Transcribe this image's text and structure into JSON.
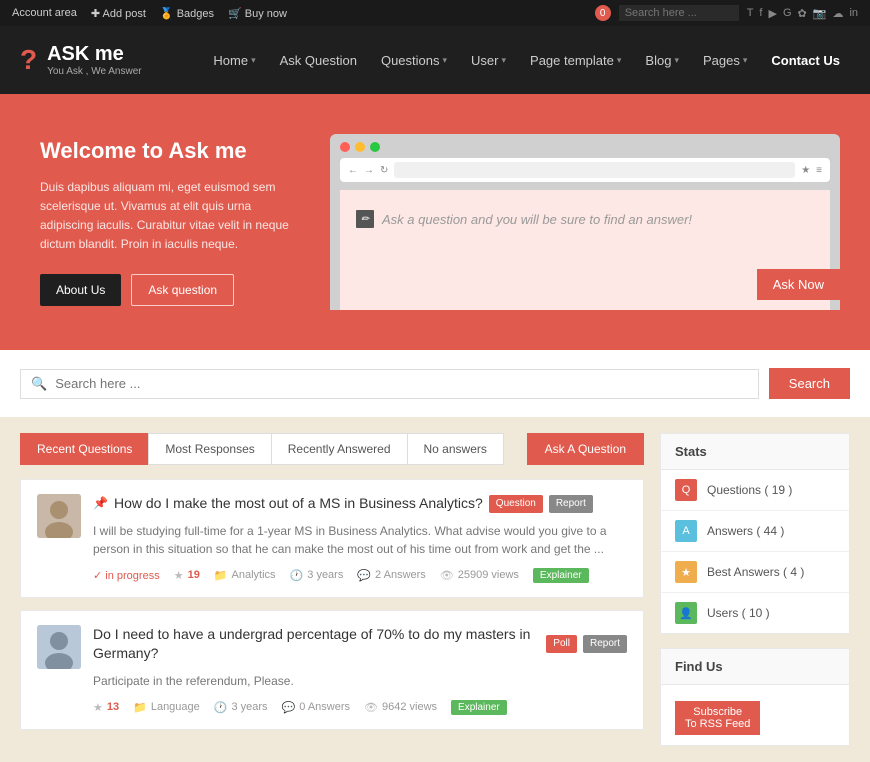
{
  "topbar": {
    "account_area": "Account area",
    "add_post": "Add post",
    "badges": "Badges",
    "buy_now": "Buy now",
    "notification_count": "0",
    "search_placeholder": "Search here ...",
    "social": [
      "T",
      "f",
      "in",
      "Y",
      "G+",
      "📷",
      "📌",
      "in"
    ]
  },
  "header": {
    "logo_icon": "?",
    "logo_title": "ASK me",
    "logo_subtitle": "You Ask , We Answer",
    "nav": [
      {
        "label": "Home",
        "has_arrow": true
      },
      {
        "label": "Ask Question",
        "has_arrow": false
      },
      {
        "label": "Questions",
        "has_arrow": true
      },
      {
        "label": "User",
        "has_arrow": true
      },
      {
        "label": "Page template",
        "has_arrow": true
      },
      {
        "label": "Blog",
        "has_arrow": true
      },
      {
        "label": "Pages",
        "has_arrow": true
      },
      {
        "label": "Contact Us",
        "has_arrow": false
      }
    ]
  },
  "hero": {
    "title": "Welcome to Ask me",
    "description": "Duis dapibus aliquam mi, eget euismod sem scelerisque ut. Vivamus at elit quis urna adipiscing iaculis. Curabitur vitae velit in neque dictum blandit. Proin in iaculis neque.",
    "btn_about": "About Us",
    "btn_ask": "Ask question",
    "browser_ask_placeholder": "Ask a question and you will be sure to find an answer!",
    "ask_now": "Ask Now"
  },
  "search": {
    "placeholder": "Search here ...",
    "btn_label": "Search"
  },
  "tabs": {
    "items": [
      {
        "label": "Recent Questions",
        "active": true
      },
      {
        "label": "Most Responses",
        "active": false
      },
      {
        "label": "Recently Answered",
        "active": false
      },
      {
        "label": "No answers",
        "active": false
      }
    ],
    "ask_btn": "Ask A Question"
  },
  "questions": [
    {
      "id": 1,
      "title": "How do I make the most out of a MS in Business Analytics?",
      "excerpt": "I will be studying full-time for a 1-year MS in Business Analytics. What advise would you give to a person in this situation so that he can make the most out of his time out from work and get the ...",
      "badge": "Question",
      "report": "Report",
      "status": "in progress",
      "stars": "19",
      "category": "Analytics",
      "time": "3 years",
      "answers": "2 Answers",
      "views": "25909 views",
      "explainer": "Explainer",
      "pinned": true
    },
    {
      "id": 2,
      "title": "Do I need to have a undergrad percentage of 70% to do my masters in Germany?",
      "excerpt": "Participate in the referendum, Please.",
      "badge": "Poll",
      "report": "Report",
      "status": "",
      "stars": "13",
      "category": "Language",
      "time": "3 years",
      "answers": "0 Answers",
      "views": "9642 views",
      "explainer": "Explainer",
      "pinned": false
    }
  ],
  "sidebar": {
    "stats_title": "Stats",
    "stats": [
      {
        "label": "Questions ( 19 )",
        "icon": "Q",
        "icon_class": "icon-q"
      },
      {
        "label": "Answers ( 44 )",
        "icon": "A",
        "icon_class": "icon-a"
      },
      {
        "label": "Best Answers ( 4 )",
        "icon": "★",
        "icon_class": "icon-ba"
      },
      {
        "label": "Users ( 10 )",
        "icon": "👤",
        "icon_class": "icon-u"
      }
    ],
    "find_us_title": "Find Us",
    "subscribe": "Subscribe",
    "rss_feed": "To RSS Feed"
  }
}
